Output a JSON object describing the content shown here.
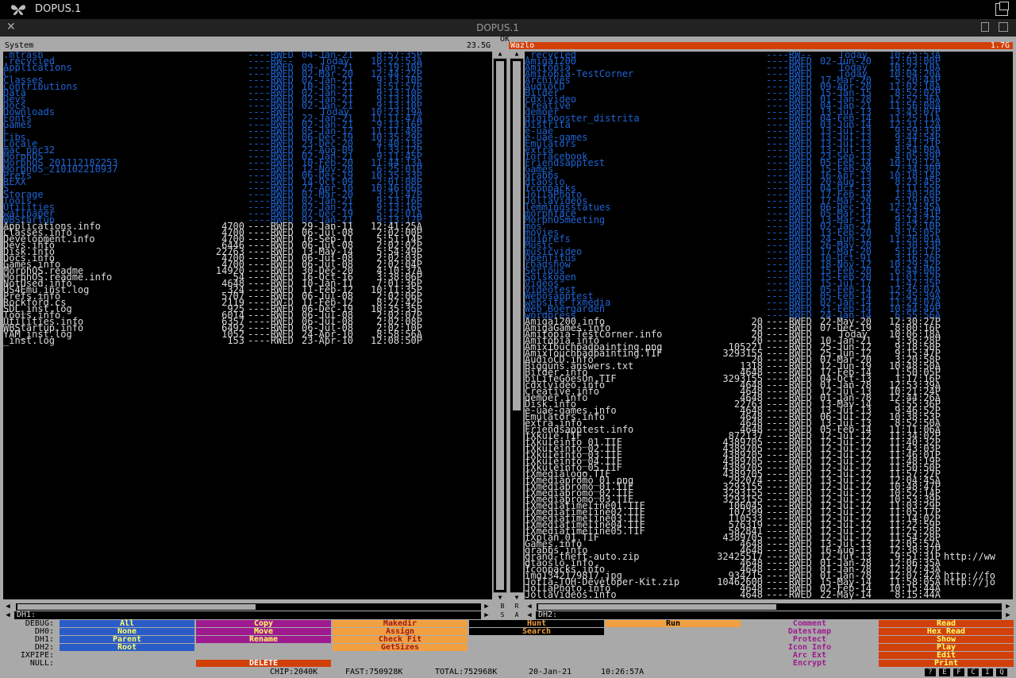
{
  "window": {
    "title": "DOPUS.1",
    "tab_title": "DOPUS.1",
    "ok_label": "OK"
  },
  "left": {
    "label": "System",
    "free": "23.5G",
    "path": "DH1:",
    "dirs": [
      {
        "n": ".mtrash",
        "p": "----RWED",
        "d": "04-Jan-21",
        "t": "8:57:35P"
      },
      {
        "n": ".recycled",
        "p": "----RW--",
        "d": "Today",
        "t": "10:22:53A"
      },
      {
        "n": "Applications",
        "p": "----RWED",
        "d": "09-Jan-21",
        "t": "5:19:10P"
      },
      {
        "n": "C",
        "p": "----RWED",
        "d": "02-Mar-20",
        "t": "12:44:22P"
      },
      {
        "n": "Classes",
        "p": "----RWED",
        "d": "02-Jan-21",
        "t": "9:13:10P"
      },
      {
        "n": "Contributions",
        "p": "----RWED",
        "d": "10-Jan-21",
        "t": "3:51:57P"
      },
      {
        "n": "Data",
        "p": "----RWED",
        "d": "02-Jan-21",
        "t": "9:13:10P"
      },
      {
        "n": "Devs",
        "p": "----RWED",
        "d": "02-Jan-21",
        "t": "9:13:10P"
      },
      {
        "n": "Docs",
        "p": "----RWED",
        "d": "02-Jan-21",
        "t": "9:13:10P"
      },
      {
        "n": "Downloads",
        "p": "----RWED",
        "d": "Today",
        "t": "10:23:19A"
      },
      {
        "n": "Fonts",
        "p": "----RWED",
        "d": "22-Jan-21",
        "t": "11:11:47A"
      },
      {
        "n": "Games",
        "p": "----RWED",
        "d": "02-Jan-21",
        "t": "9:13:16P"
      },
      {
        "n": "L",
        "p": "----RWED",
        "d": "05-Jan-12",
        "t": "11:11:49P"
      },
      {
        "n": "Libs",
        "p": "----RWED",
        "d": "06-Dec-19",
        "t": "10:35:29P"
      },
      {
        "n": "Locale",
        "p": "----RWED",
        "d": "23-Dec-20",
        "t": "4:40:13P"
      },
      {
        "n": "mac_ppc32",
        "p": "----RWED",
        "d": "22-Aug-09",
        "t": "1:33:12P"
      },
      {
        "n": "MorphOS",
        "p": "----RWED",
        "d": "02-Jan-21",
        "t": "9:11:45P"
      },
      {
        "n": "MorphOS_201112182253",
        "p": "----RWED",
        "d": "10-Feb-20",
        "t": "11:44:13A"
      },
      {
        "n": "MorphOS_210102210937",
        "p": "----RWED",
        "d": "12-Nov-20",
        "t": "6:25:01P"
      },
      {
        "n": "Prefs",
        "p": "----RWED",
        "d": "06-Dec-19",
        "t": "10:35:33P"
      },
      {
        "n": "REXX",
        "p": "----RWED",
        "d": "14-Oct-09",
        "t": "2:01:08P"
      },
      {
        "n": "S",
        "p": "----RWED",
        "d": "27-Apr-10",
        "t": "10:46:06P"
      },
      {
        "n": "Storage",
        "p": "----RWED",
        "d": "07-Mar-20",
        "t": "3:21:47P"
      },
      {
        "n": "Tools",
        "p": "----RWED",
        "d": "02-Jan-21",
        "t": "9:13:16P"
      },
      {
        "n": "Utilities",
        "p": "----RWED",
        "d": "02-Jan-21",
        "t": "9:13:16P"
      },
      {
        "n": "wallpaper",
        "p": "----RWED",
        "d": "07-Dec-19",
        "t": "5:12:01A"
      },
      {
        "n": "WBStartup",
        "p": "----RWED",
        "d": "02-Jan-21",
        "t": "9:13:17P"
      }
    ],
    "files": [
      {
        "n": "Applications.info",
        "s": "4700",
        "p": "----RWED",
        "d": "29-Jan-11",
        "t": "12:41:25A"
      },
      {
        "n": "Classes.info",
        "s": "4700",
        "p": "----RWED",
        "d": "06-Jul-08",
        "t": "2:02:00P"
      },
      {
        "n": "Development.info",
        "s": "4700",
        "p": "----RWED",
        "d": "16-Sep-11",
        "t": "5:51:14P"
      },
      {
        "n": "Devs.info",
        "s": "6446",
        "p": "----RWED",
        "d": "06-Jul-08",
        "t": "2:02:02P"
      },
      {
        "n": "Disk.info",
        "s": "22763",
        "p": "----RWED",
        "d": "13-May-14",
        "t": "5:54:49P"
      },
      {
        "n": "Docs.info",
        "s": "4700",
        "p": "----RWED",
        "d": "06-Jul-08",
        "t": "2:02:03P"
      },
      {
        "n": "Games.info",
        "s": "4700",
        "p": "----RWED",
        "d": "06-Jul-08",
        "t": "2:02:04P"
      },
      {
        "n": "MorphOS.readme",
        "s": "14920",
        "p": "----RWED",
        "d": "30-Dec-20",
        "t": "4:10:37A"
      },
      {
        "n": "MorphOS.readme.info",
        "s": "54",
        "p": "----RWED",
        "d": "16-Oct-16",
        "t": "3:38:06P"
      },
      {
        "n": "NotUsed.info",
        "s": "4648",
        "p": "----RWED",
        "d": "10-Jan-11",
        "t": "7:01:36P"
      },
      {
        "n": "OS4Emu_inst.log",
        "s": "324",
        "p": "----RWED",
        "d": "11-Feb-12",
        "t": "10:11:35P"
      },
      {
        "n": "Prefs.info",
        "s": "5707",
        "p": "----RWED",
        "d": "06-Jul-08",
        "t": "2:02:06P"
      },
      {
        "n": "Rockford.cs",
        "s": "2119",
        "p": "----RW-D",
        "d": "11-Feb-12",
        "t": "8:27:42P"
      },
      {
        "n": "SDL_inst.log",
        "s": "925",
        "p": "----RWED",
        "d": "06-Dec-19",
        "t": "10:35:35P"
      },
      {
        "n": "Tools.info",
        "s": "6014",
        "p": "----RWED",
        "d": "06-Jul-08",
        "t": "2:02:07P"
      },
      {
        "n": "Utilities.info",
        "s": "6357",
        "p": "----RWED",
        "d": "06-Jul-08",
        "t": "2:02:08P"
      },
      {
        "n": "WBStartup.info",
        "s": "6492",
        "p": "----RWED",
        "d": "06-Jul-08",
        "t": "2:02:10P"
      },
      {
        "n": "YAM_inst.log",
        "s": "1052",
        "p": "----RWED",
        "d": "24-Apr-10",
        "t": "8:58:56A"
      },
      {
        "n": "_inst.log",
        "s": "153",
        "p": "----RWED",
        "d": "23-Apr-10",
        "t": "12:08:50P"
      }
    ]
  },
  "right": {
    "label": "Wazlo",
    "free": "1.7G",
    "path": "DH2:",
    "dirs": [
      {
        "n": ".recycled",
        "p": "----RW--",
        "d": "Today",
        "t": "10:25:53A"
      },
      {
        "n": "Amiga1200",
        "p": "----RWED",
        "d": "02-Jun-20",
        "t": "12:03:00P"
      },
      {
        "n": "Amitopia",
        "p": "----RWED",
        "d": "Today",
        "t": "10:22:10A"
      },
      {
        "n": "Amitopia-TestCorner",
        "p": "----RWED",
        "d": "Today",
        "t": "10:04:20A"
      },
      {
        "n": "Archives",
        "p": "----RWED",
        "d": "17-Mar-20",
        "t": "5:20:44P"
      },
      {
        "n": "AudioCD",
        "p": "----RWED",
        "d": "09-Apr-20",
        "t": "11:02:18A"
      },
      {
        "n": "Bilder",
        "p": "----RWED",
        "d": "15-Jan-15",
        "t": "8:52:02P"
      },
      {
        "n": "cdxlvideo",
        "p": "----RWED",
        "d": "01-Jan-78",
        "t": "12:52:36A"
      },
      {
        "n": "Creative",
        "p": "----RWED",
        "d": "04-Jan-21",
        "t": "11:56:00A"
      },
      {
        "n": "demoer",
        "p": "----RWED",
        "d": "13-Jul-13",
        "t": "3:43:07P"
      },
      {
        "n": "digibooster_distrita",
        "p": "----RWED",
        "d": "04-Feb-14",
        "t": "11:25:11A"
      },
      {
        "n": "Distrita",
        "p": "----RWED",
        "d": "03-Jun-14",
        "t": "12:31:12A"
      },
      {
        "n": "e-uae",
        "p": "----RWED",
        "d": "13-Jul-13",
        "t": "9:59:33P"
      },
      {
        "n": "e-uae-games",
        "p": "----RWED",
        "d": "13-Jul-13",
        "t": "9:44:54P"
      },
      {
        "n": "Emulators",
        "p": "----RWED",
        "d": "13-Jul-13",
        "t": "3:41:21P"
      },
      {
        "n": "extra",
        "p": "----RWED",
        "d": "13-Jul-13",
        "t": "8:54:08A"
      },
      {
        "n": "forfacebook",
        "p": "----RWED",
        "d": "23-Sep-13",
        "t": "4:05:39P"
      },
      {
        "n": "Friendsapptest",
        "p": "----RWED",
        "d": "05-Feb-14",
        "t": "10:19:12A"
      },
      {
        "n": "Games",
        "p": "----RWED",
        "d": "15-Feb-20",
        "t": "7:34:30P"
      },
      {
        "n": "grabbs",
        "p": "----RWED",
        "d": "16-Apr-13",
        "t": "10:18:14P"
      },
      {
        "n": "gtaoslo",
        "p": "----RWED",
        "d": "20-Aug-13",
        "t": "8:23:45P"
      },
      {
        "n": "Iconpacks",
        "p": "----RWED",
        "d": "04-Oct-13",
        "t": "1:11:55P"
      },
      {
        "n": "JollaPhoto",
        "p": "----RWED",
        "d": "17-Feb-14",
        "t": "1:30:20P"
      },
      {
        "n": "JollaVideos",
        "p": "----RWED",
        "d": "17-Mar-20",
        "t": "5:19:03P"
      },
      {
        "n": "lemmingsstatues",
        "p": "----RWED",
        "d": "06-Dec-14",
        "t": "12:24:45A"
      },
      {
        "n": "morphface",
        "p": "----RWED",
        "d": "05-Mar-14",
        "t": "5:23:41P"
      },
      {
        "n": "MorphOSmeeting",
        "p": "----RWED",
        "d": "13-Mar-14",
        "t": "9:14:22P"
      },
      {
        "n": "mos",
        "p": "----RWED",
        "d": "02-Jan-21",
        "t": "8:52:10P"
      },
      {
        "n": "movies",
        "p": "----RWED",
        "d": "13-Feb-20",
        "t": "9:15:05P"
      },
      {
        "n": "muiprefs",
        "p": "----RWED",
        "d": "24-Jun-12",
        "t": "11:26:01A"
      },
      {
        "n": "Music",
        "p": "----RWED",
        "d": "26-May-20",
        "t": "1:30:33P"
      },
      {
        "n": "musicvideo",
        "p": "----RWED",
        "d": "17-Mar-20",
        "t": "5:16:17P"
      },
      {
        "n": "OpenTitus",
        "p": "----RWED",
        "d": "10-Oct-91",
        "t": "3:16:26P"
      },
      {
        "n": "roadshow",
        "p": "----RWED",
        "d": "18-Nov-12",
        "t": "10:29:42P"
      },
      {
        "n": "Serious",
        "p": "----RWED",
        "d": "15-Feb-20",
        "t": "6:44:00P"
      },
      {
        "n": "Solskogen",
        "p": "----RWED",
        "d": "15-Feb-20",
        "t": "11:01:32P"
      },
      {
        "n": "Videos",
        "p": "----RWED",
        "d": "15-Jul-17",
        "t": "1:47:35P"
      },
      {
        "n": "Videotest",
        "p": "----RWED",
        "d": "05-Feb-14",
        "t": "12:45:07A"
      },
      {
        "n": "Webosapptest",
        "p": "----RWED",
        "d": "05-Feb-14",
        "t": "12:45:39A"
      },
      {
        "n": "website_fxmedia",
        "p": "----RWED",
        "d": "02-Jan-14",
        "t": "11:24:07A"
      },
      {
        "n": "Web_Boergarden",
        "p": "----RWED",
        "d": "21-Feb-14",
        "t": "10:44:49P"
      },
      {
        "n": "wordpress",
        "p": "----RWED",
        "d": "24-Jan-14",
        "t": "6:55:56A"
      }
    ],
    "files": [
      {
        "n": "Amiga1200.info",
        "s": "20",
        "p": "----RWED",
        "d": "22-May-20",
        "t": "12:30:27P"
      },
      {
        "n": "AmigaGames.info",
        "s": "20",
        "p": "----RWED",
        "d": "07-Dec-19",
        "t": "8:00:16P"
      },
      {
        "n": "Amitopia-TestCorner.info",
        "s": "20",
        "p": "----RWED",
        "d": "Today",
        "t": "10:06:18A"
      },
      {
        "n": "Amitopia.info",
        "s": "20",
        "p": "----RWED",
        "d": "10-Jan-21",
        "t": "3:36:28P"
      },
      {
        "n": "AmixTouchpadpainting.png",
        "s": "105221",
        "p": "----RWED",
        "d": "25-Jun-12",
        "t": "9:18:50P"
      },
      {
        "n": "AmixTouchpadpainting.TIF",
        "s": "3293155",
        "p": "----RWED",
        "d": "25-Jun-12",
        "t": "9:15:47P"
      },
      {
        "n": "AudioCD.info",
        "s": "20",
        "p": "----RWED",
        "d": "07-Mar-20",
        "t": "3:20:58P"
      },
      {
        "n": "Bigguns answers.txt",
        "s": "1318",
        "p": "----RWED",
        "d": "12-Jun-19",
        "t": "10:48:50A"
      },
      {
        "n": "Bilder.info",
        "s": "4648",
        "p": "----RWED",
        "d": "17-Feb-14",
        "t": "1:50:05P"
      },
      {
        "n": "biLifeGoesOn.TIF",
        "s": "3293155",
        "p": "----RWED",
        "d": "04-Oct-13",
        "t": "1:17:16P"
      },
      {
        "n": "cdxlvideo.info",
        "s": "4648",
        "p": "----RWED",
        "d": "01-Jan-78",
        "t": "12:53:39A"
      },
      {
        "n": "Creative.info",
        "s": "4648",
        "p": "----RWED",
        "d": "12-Jul-13",
        "t": "10:21:24P"
      },
      {
        "n": "demoer.info",
        "s": "4648",
        "p": "----RWED",
        "d": "01-Jan-78",
        "t": "12:44:26A"
      },
      {
        "n": "Disk.info",
        "s": "22763",
        "p": "----RWED",
        "d": "13-May-14",
        "t": "5:55:36P"
      },
      {
        "n": "e-uae-games.info",
        "s": "4648",
        "p": "----RWED",
        "d": "13-Jul-13",
        "t": "9:46:52P"
      },
      {
        "n": "Emulators.info",
        "s": "4648",
        "p": "----RWED",
        "d": "06-Jul-12",
        "t": "10:38:53P"
      },
      {
        "n": "extra.info",
        "s": "4648",
        "p": "----RWED",
        "d": "13-Jul-13",
        "t": "8:52:50A"
      },
      {
        "n": "Friendsapptest.info",
        "s": "4648",
        "p": "----RWED",
        "d": "05-Feb-14",
        "t": "11:11:06A"
      },
      {
        "n": "fXkule.TIF",
        "s": "872137",
        "p": "----RWED",
        "d": "12-Jul-12",
        "t": "11:34:02P"
      },
      {
        "n": "fXkuleinfo_01.TIF",
        "s": "4389705",
        "p": "----RWED",
        "d": "12-Jul-12",
        "t": "11:40:32P"
      },
      {
        "n": "fXkuleinfo_02.TIF",
        "s": "4389705",
        "p": "----RWED",
        "d": "12-Jul-12",
        "t": "11:43:03P"
      },
      {
        "n": "fXkuleinfo_03.TIF",
        "s": "4389705",
        "p": "----RWED",
        "d": "12-Jul-12",
        "t": "11:46:01P"
      },
      {
        "n": "fXkuleinfo_04.TIF",
        "s": "4389705",
        "p": "----RWED",
        "d": "12-Jul-12",
        "t": "11:48:19P"
      },
      {
        "n": "fXkuleinfo_05.TIF",
        "s": "4389705",
        "p": "----RWED",
        "d": "12-Jul-12",
        "t": "11:50:50P"
      },
      {
        "n": "fXmedialogo.TIF",
        "s": "4389705",
        "p": "----RWED",
        "d": "12-Jul-12",
        "t": "11:57:27P"
      },
      {
        "n": "fXmediapromo_01.png",
        "s": "292074",
        "p": "----RWED",
        "d": "13-Jul-12",
        "t": "12:04:45A"
      },
      {
        "n": "fXmediapromo_01.TIF",
        "s": "3293155",
        "p": "----RWED",
        "d": "12-Jul-12",
        "t": "10:48:47P"
      },
      {
        "n": "fXmediapromo_02.TIF",
        "s": "3293155",
        "p": "----RWED",
        "d": "12-Jul-12",
        "t": "10:52:14P"
      },
      {
        "n": "fXmediapromo_03.TIF",
        "s": "3293155",
        "p": "----RWED",
        "d": "12-Jul-12",
        "t": "10:53:39P"
      },
      {
        "n": "fXmediatimeline01.TIF",
        "s": "106045",
        "p": "----RWED",
        "d": "12-Jul-12",
        "t": "11:03:29P"
      },
      {
        "n": "fXmediatimeline02.TIF",
        "s": "107399",
        "p": "----RWED",
        "d": "12-Jul-12",
        "t": "11:05:17P"
      },
      {
        "n": "fXmediatimeline03.TIF",
        "s": "110533",
        "p": "----RWED",
        "d": "12-Jul-12",
        "t": "11:14:02P"
      },
      {
        "n": "fXmediatimeline04.TIF",
        "s": "576319",
        "p": "----RWED",
        "d": "12-Jul-12",
        "t": "11:22:59P"
      },
      {
        "n": "fXmediatimeline05.TIF",
        "s": "582841",
        "p": "----RWED",
        "d": "12-Jul-12",
        "t": "11:25:28P"
      },
      {
        "n": "fXplan_01.TIF",
        "s": "4389705",
        "p": "----RWED",
        "d": "12-Jul-12",
        "t": "11:54:28P"
      },
      {
        "n": "Games.info",
        "s": "4648",
        "p": "----RWED",
        "d": "13-Jul-13",
        "t": "12:05:57A"
      },
      {
        "n": "grabbs.info",
        "s": "4648",
        "p": "----RWED",
        "d": "16-Aug-13",
        "t": "12:38:37P"
      },
      {
        "n": "grand-theft-auto.zip",
        "s": "32425517",
        "p": "----RWED",
        "d": "12-Jul-13",
        "t": "9:51:31P",
        "x": "http://ww"
      },
      {
        "n": "gtaoslo.info",
        "s": "4648",
        "p": "----RWED",
        "d": "01-Jan-78",
        "t": "12:06:35A"
      },
      {
        "n": "Iconpacks.info",
        "s": "4648",
        "p": "----RWED",
        "d": "01-Jan-78",
        "t": "12:07:43A"
      },
      {
        "n": "img1342179817.jpg",
        "s": "934215",
        "p": "----RWED",
        "d": "01-Jan-78",
        "t": "12:07:42A",
        "x": "http://fo"
      },
      {
        "n": "Jolla-TOH-Developer-Kit.zip",
        "s": "10462600",
        "p": "----RWED",
        "d": "15-May-14",
        "t": "11:58:05A",
        "x": "http://jo"
      },
      {
        "n": "JollaPhoto.info",
        "s": "4648",
        "p": "----RWED",
        "d": "02-Feb-14",
        "t": "10:15:44A"
      },
      {
        "n": "JollaVideos.info",
        "s": "4648",
        "p": "----RWED",
        "d": "22-May-14",
        "t": "8:15:44A"
      }
    ]
  },
  "mid_buttons": {
    "b": "B",
    "r": "R",
    "s": "S",
    "a": "A"
  },
  "side_labels": [
    "DEBUG:",
    "DH0:",
    "DH1:",
    "DH2:",
    "IXPIPE:",
    "NULL:"
  ],
  "buttons": {
    "col1": [
      "All",
      "None",
      "Parent",
      "Root",
      "",
      ""
    ],
    "col2": [
      "Copy",
      "Move",
      "Rename",
      "",
      "",
      "DELETE"
    ],
    "col3": [
      "Makedir",
      "Assign",
      "Check Fit",
      "GetSizes",
      "",
      ""
    ],
    "col4": [
      "Hunt",
      "Search",
      "",
      "",
      "",
      ""
    ],
    "col5": [
      "Run",
      "",
      "",
      "",
      "",
      ""
    ],
    "col6": [
      "Comment",
      "Datestamp",
      "Protect",
      "Icon Info",
      "Arc Ext",
      "Encrypt"
    ],
    "col7": [
      "Read",
      "Hex Read",
      "Show",
      "Play",
      "Edit",
      "Print"
    ]
  },
  "status": {
    "chip": "CHIP:2040K",
    "fast": "FAST:750928K",
    "total": "TOTAL:752968K",
    "date": "20-Jan-21",
    "time": "10:26:57A"
  },
  "quick": [
    "?",
    "E",
    "F",
    "C",
    "I",
    "Q"
  ],
  "colors": {
    "screen": "#a9a9a9",
    "dir": "#1f64d4",
    "file": "#dddddd",
    "active_header": "#d2400a",
    "blue_btn": "#2a5cc8",
    "purple_btn": "#9e1a8e",
    "orange_btn": "#f0a040",
    "red_btn": "#d2400a"
  }
}
